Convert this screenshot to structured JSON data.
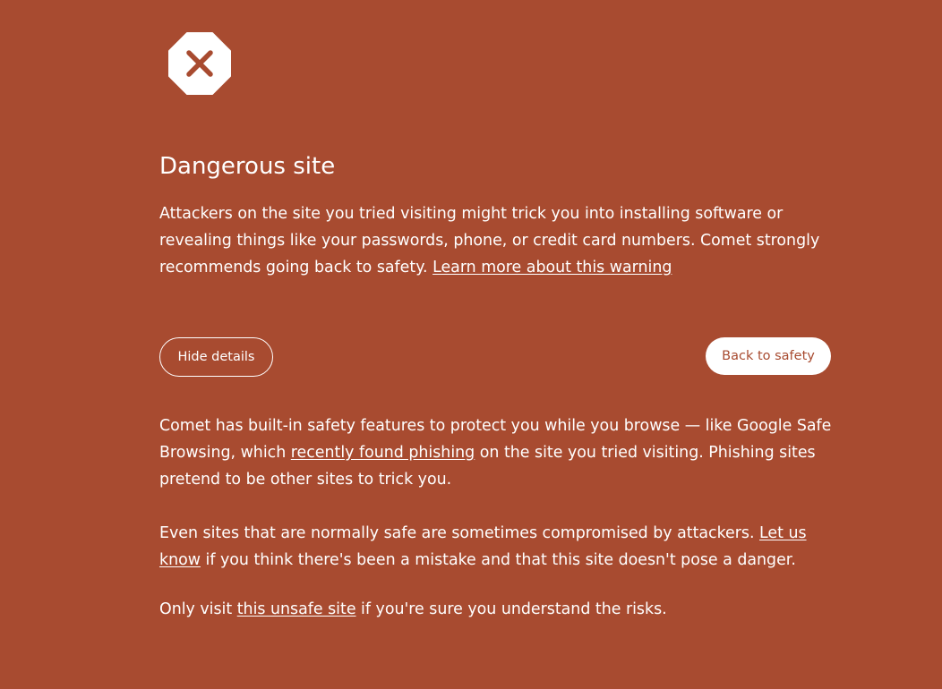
{
  "colors": {
    "background": "#a84b30",
    "text": "#ffffff",
    "primary_button_bg": "#ffffff",
    "primary_button_text": "#a84b30"
  },
  "icon": "stop-sign-x-icon",
  "title": "Dangerous site",
  "main_message": {
    "text": "Attackers on the site you tried visiting might trick you into installing software or revealing things like your passwords, phone, or credit card numbers. Comet strongly recommends going back to safety. ",
    "link": "Learn more about this warning"
  },
  "buttons": {
    "hide_details": "Hide details",
    "back_to_safety": "Back to safety"
  },
  "details": {
    "p1_before": "Comet has built-in safety features to protect you while you browse — like Google Safe Browsing, which ",
    "p1_link": "recently found phishing",
    "p1_after": " on the site you tried visiting. Phishing sites pretend to be other sites to trick you.",
    "p2_before": "Even sites that are normally safe are sometimes compromised by attackers. ",
    "p2_link": "Let us know",
    "p2_after": " if you think there's been a mistake and that this site doesn't pose a danger.",
    "p3_before": "Only visit ",
    "p3_link": "this unsafe site",
    "p3_after": " if you're sure you understand the risks."
  }
}
